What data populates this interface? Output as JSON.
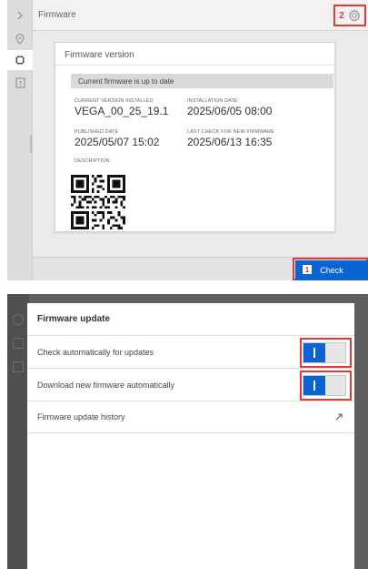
{
  "panel1": {
    "header": {
      "title": "Firmware",
      "settings_badge": "2"
    },
    "card": {
      "title": "Firmware version",
      "status": "Current firmware is up to date",
      "fields": {
        "current_version": {
          "label": "CURRENT VERSION INSTALLED",
          "value": "VEGA_00_25_19.1"
        },
        "installation_date": {
          "label": "INSTALLATION DATE",
          "value": "2025/06/05 08:00"
        },
        "published_date": {
          "label": "PUBLISHED DATE",
          "value": "2025/05/07 15:02"
        },
        "last_check": {
          "label": "LAST CHECK FOR NEW FIRMWARE",
          "value": "2025/06/13 16:35"
        },
        "description": {
          "label": "DESCRIPTION"
        }
      }
    },
    "check_button": {
      "label": "Check",
      "badge": "1"
    }
  },
  "panel2": {
    "dialog": {
      "title": "Firmware update",
      "options": [
        {
          "label": "Check automatically for updates",
          "enabled": true
        },
        {
          "label": "Download new firmware automatically",
          "enabled": true
        }
      ],
      "history_link": "Firmware update history"
    }
  },
  "colors": {
    "accent": "#0a64d4",
    "highlight_red": "#e53935"
  }
}
